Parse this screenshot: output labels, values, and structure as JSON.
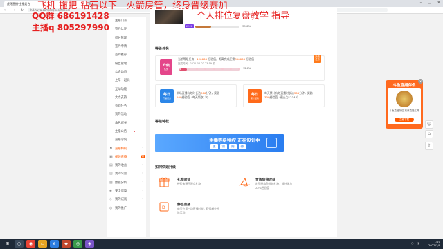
{
  "browser": {
    "tab_title": "虎牙直播-主播后台",
    "url": "hd.huya.com/anchor/#/level"
  },
  "overlay": {
    "line1": "飞机 拖把 钻石以下　火箭房管，终身晋级赛加",
    "line2": "QQ群 686191428",
    "line3": "主播q 805297990",
    "line4": "个人排位复盘教学 指导"
  },
  "sidebar": {
    "items": [
      {
        "label": "主播门派"
      },
      {
        "label": "签约认证"
      },
      {
        "label": "积分管理"
      },
      {
        "label": "签约申请"
      },
      {
        "label": "签约推荐"
      },
      {
        "label": "粉丝管理"
      },
      {
        "label": "公会动态"
      },
      {
        "label": "上车一起玩"
      },
      {
        "label": "互动功能"
      },
      {
        "label": "大力支持"
      },
      {
        "label": "签到任务"
      },
      {
        "label": "我的活动"
      },
      {
        "label": "角色成长"
      },
      {
        "label": "主播公告"
      },
      {
        "label": "直播学院"
      },
      {
        "label": "直播特权"
      },
      {
        "label": "视频直播",
        "badge": "新"
      },
      {
        "label": "我的收益"
      },
      {
        "label": "我的公会"
      },
      {
        "label": "数据分析"
      },
      {
        "label": "安全保障"
      },
      {
        "label": "我的成就"
      },
      {
        "label": "我的推广"
      }
    ]
  },
  "profile": {
    "level_badge": "LV.26",
    "level_progress": 35.6,
    "level_pct_text": "35.6%"
  },
  "tasks": {
    "title": "等级任务",
    "upgrade": {
      "icon_title": "升级",
      "icon_sub": "任务",
      "line1_a": "当前等级任务：",
      "line1_b": "120000",
      "line1_c": " 经验值，距离完成还需",
      "line1_d": "350000",
      "line1_e": " 经验值",
      "line2": "完成时间：2021-08-02 23:59 前",
      "progress": 12.6,
      "progress_text": "12.6%",
      "tag_l1": "升级",
      "tag_l2": "任务"
    },
    "daily1": {
      "icon_title": "每日",
      "icon_sub": "开播任务",
      "line1": "单场直播有效时长达",
      "hl1": "300",
      "line1b": "分钟，奖励",
      "hl2": "100",
      "line2": "经验值（每天领取1次）"
    },
    "daily2": {
      "icon_title": "每日",
      "icon_sub": "累计任务",
      "line1": "每天累计有效直播时长达",
      "hl1": "300",
      "line1b": "分钟，奖励",
      "hl2": "300",
      "line2": "经验值（截止为12348）"
    }
  },
  "privilege": {
    "title": "等级特权",
    "banner_title": "主播等级特权 正在设计中",
    "pills": [
      "敬",
      "请",
      "期",
      "待"
    ]
  },
  "ways": {
    "title": "如何快速升级",
    "items": [
      {
        "title": "礼物收益",
        "desc": "经验来源于观众礼物"
      },
      {
        "title": "贵族鱼翅收益",
        "desc": "收到贵族鱼翅的礼物，额外增加\n20%经验值"
      },
      {
        "title": "静态直播",
        "desc": "每天在第一场直播时长，获得额外经\n验奖励"
      }
    ]
  },
  "promo": {
    "head": "斗鱼直播伴侣",
    "text": "斗鱼直播伴侣 推荐直播工具",
    "button": "立即下载"
  },
  "taskbar": {
    "time": "1:20",
    "date": "2022/1/9"
  }
}
